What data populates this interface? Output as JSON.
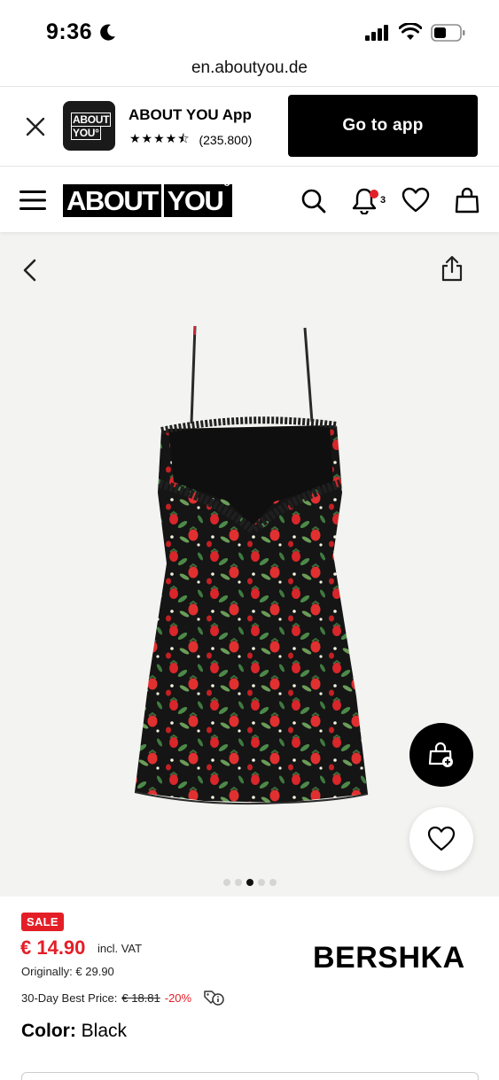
{
  "status_bar": {
    "time": "9:36"
  },
  "url": "en.aboutyou.de",
  "app_banner": {
    "logo_line1": "ABOUT",
    "logo_line2": "YOU°",
    "app_name": "ABOUT YOU App",
    "stars": "★★★★⯪",
    "rating_count": "(235.800)",
    "cta": "Go to app"
  },
  "header": {
    "logo_part1": "ABOUT",
    "logo_part2": "YOU",
    "logo_sup": "o",
    "notification_count": "3"
  },
  "gallery": {
    "dots": 5,
    "active_dot": 3
  },
  "product": {
    "sale_badge": "SALE",
    "price": "€ 14.90",
    "vat": "incl. VAT",
    "original": "Originally: € 29.90",
    "best_price_label": "30-Day Best Price:",
    "best_price_value": "€ 18.81",
    "best_price_discount": "-20%",
    "brand": "BERSHKA",
    "color_label": "Color:",
    "color_value": "Black"
  },
  "colors": {
    "sale_red": "#e41e26",
    "black": "#000000",
    "gallery_bg": "#f3f3f1"
  }
}
